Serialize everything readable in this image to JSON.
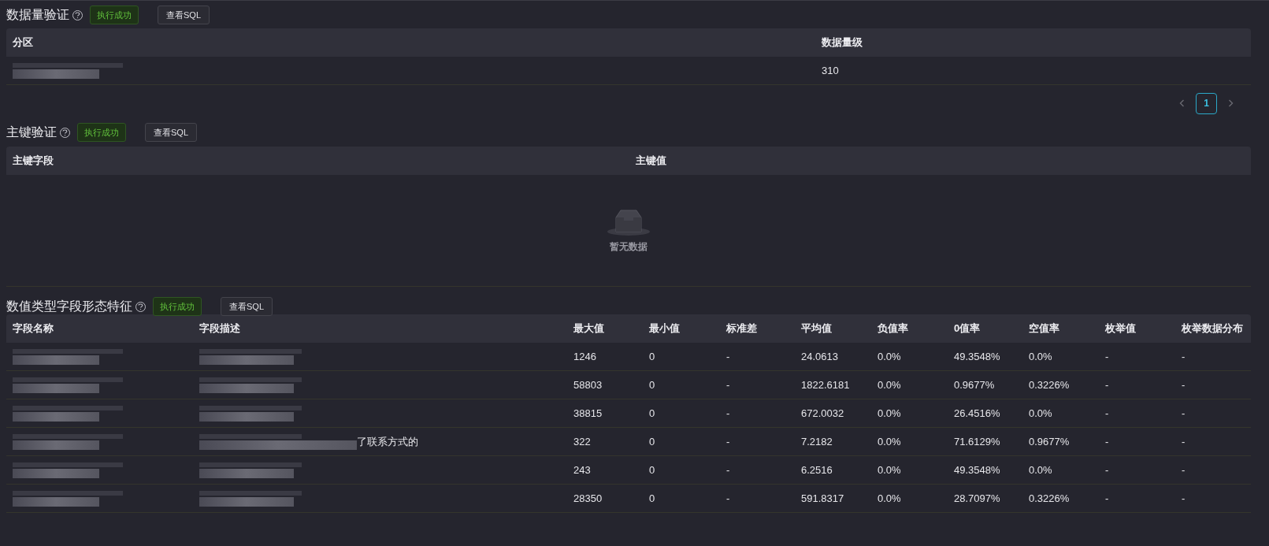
{
  "sections": [
    {
      "title": "数据量验证",
      "status": "执行成功",
      "sql_button": "查看SQL",
      "kind": "partition",
      "columns": [
        "分区",
        "数据量级"
      ],
      "rows": [
        [
          {
            "kind": "redacted"
          },
          {
            "kind": "text",
            "text": "310"
          }
        ]
      ],
      "pagination": {
        "pages": [
          {
            "label": "1",
            "selected": true
          }
        ]
      }
    },
    {
      "title": "主键验证",
      "status": "执行成功",
      "sql_button": "查看SQL",
      "kind": "primary_key",
      "columns": [
        "主键字段",
        "主键值"
      ],
      "empty_text": "暂无数据"
    },
    {
      "title": "数值类型字段形态特征",
      "status": "执行成功",
      "sql_button": "查看SQL",
      "kind": "numeric",
      "columns": [
        "字段名称",
        "字段描述",
        "最大值",
        "最小值",
        "标准差",
        "平均值",
        "负值率",
        "0值率",
        "空值率",
        "枚举值",
        "枚举数据分布"
      ],
      "rows": [
        [
          {
            "kind": "redacted"
          },
          {
            "kind": "redacted"
          },
          {
            "kind": "text",
            "text": "1246"
          },
          {
            "kind": "text",
            "text": "0"
          },
          {
            "kind": "text",
            "text": "-"
          },
          {
            "kind": "text",
            "text": "24.0613"
          },
          {
            "kind": "text",
            "text": "0.0%"
          },
          {
            "kind": "text",
            "text": "49.3548%"
          },
          {
            "kind": "text",
            "text": "0.0%"
          },
          {
            "kind": "text",
            "text": "-"
          },
          {
            "kind": "text",
            "text": "-"
          }
        ],
        [
          {
            "kind": "redacted"
          },
          {
            "kind": "redacted"
          },
          {
            "kind": "text",
            "text": "58803"
          },
          {
            "kind": "text",
            "text": "0"
          },
          {
            "kind": "text",
            "text": "-"
          },
          {
            "kind": "text",
            "text": "1822.6181"
          },
          {
            "kind": "text",
            "text": "0.0%"
          },
          {
            "kind": "text",
            "text": "0.9677%"
          },
          {
            "kind": "text",
            "text": "0.3226%"
          },
          {
            "kind": "text",
            "text": "-"
          },
          {
            "kind": "text",
            "text": "-"
          }
        ],
        [
          {
            "kind": "redacted"
          },
          {
            "kind": "redacted"
          },
          {
            "kind": "text",
            "text": "38815"
          },
          {
            "kind": "text",
            "text": "0"
          },
          {
            "kind": "text",
            "text": "-"
          },
          {
            "kind": "text",
            "text": "672.0032"
          },
          {
            "kind": "text",
            "text": "0.0%"
          },
          {
            "kind": "text",
            "text": "26.4516%"
          },
          {
            "kind": "text",
            "text": "0.0%"
          },
          {
            "kind": "text",
            "text": "-"
          },
          {
            "kind": "text",
            "text": "-"
          }
        ],
        [
          {
            "kind": "redacted"
          },
          {
            "kind": "redacted",
            "text": "了联系方式的"
          },
          {
            "kind": "text",
            "text": "322"
          },
          {
            "kind": "text",
            "text": "0"
          },
          {
            "kind": "text",
            "text": "-"
          },
          {
            "kind": "text",
            "text": "7.2182"
          },
          {
            "kind": "text",
            "text": "0.0%"
          },
          {
            "kind": "text",
            "text": "71.6129%"
          },
          {
            "kind": "text",
            "text": "0.9677%"
          },
          {
            "kind": "text",
            "text": "-"
          },
          {
            "kind": "text",
            "text": "-"
          }
        ],
        [
          {
            "kind": "redacted"
          },
          {
            "kind": "redacted"
          },
          {
            "kind": "text",
            "text": "243"
          },
          {
            "kind": "text",
            "text": "0"
          },
          {
            "kind": "text",
            "text": "-"
          },
          {
            "kind": "text",
            "text": "6.2516"
          },
          {
            "kind": "text",
            "text": "0.0%"
          },
          {
            "kind": "text",
            "text": "49.3548%"
          },
          {
            "kind": "text",
            "text": "0.0%"
          },
          {
            "kind": "text",
            "text": "-"
          },
          {
            "kind": "text",
            "text": "-"
          }
        ],
        [
          {
            "kind": "redacted"
          },
          {
            "kind": "redacted"
          },
          {
            "kind": "text",
            "text": "28350"
          },
          {
            "kind": "text",
            "text": "0"
          },
          {
            "kind": "text",
            "text": "-"
          },
          {
            "kind": "text",
            "text": "591.8317"
          },
          {
            "kind": "text",
            "text": "0.0%"
          },
          {
            "kind": "text",
            "text": "28.7097%"
          },
          {
            "kind": "text",
            "text": "0.3226%"
          },
          {
            "kind": "text",
            "text": "-"
          },
          {
            "kind": "text",
            "text": "-"
          }
        ]
      ]
    }
  ]
}
